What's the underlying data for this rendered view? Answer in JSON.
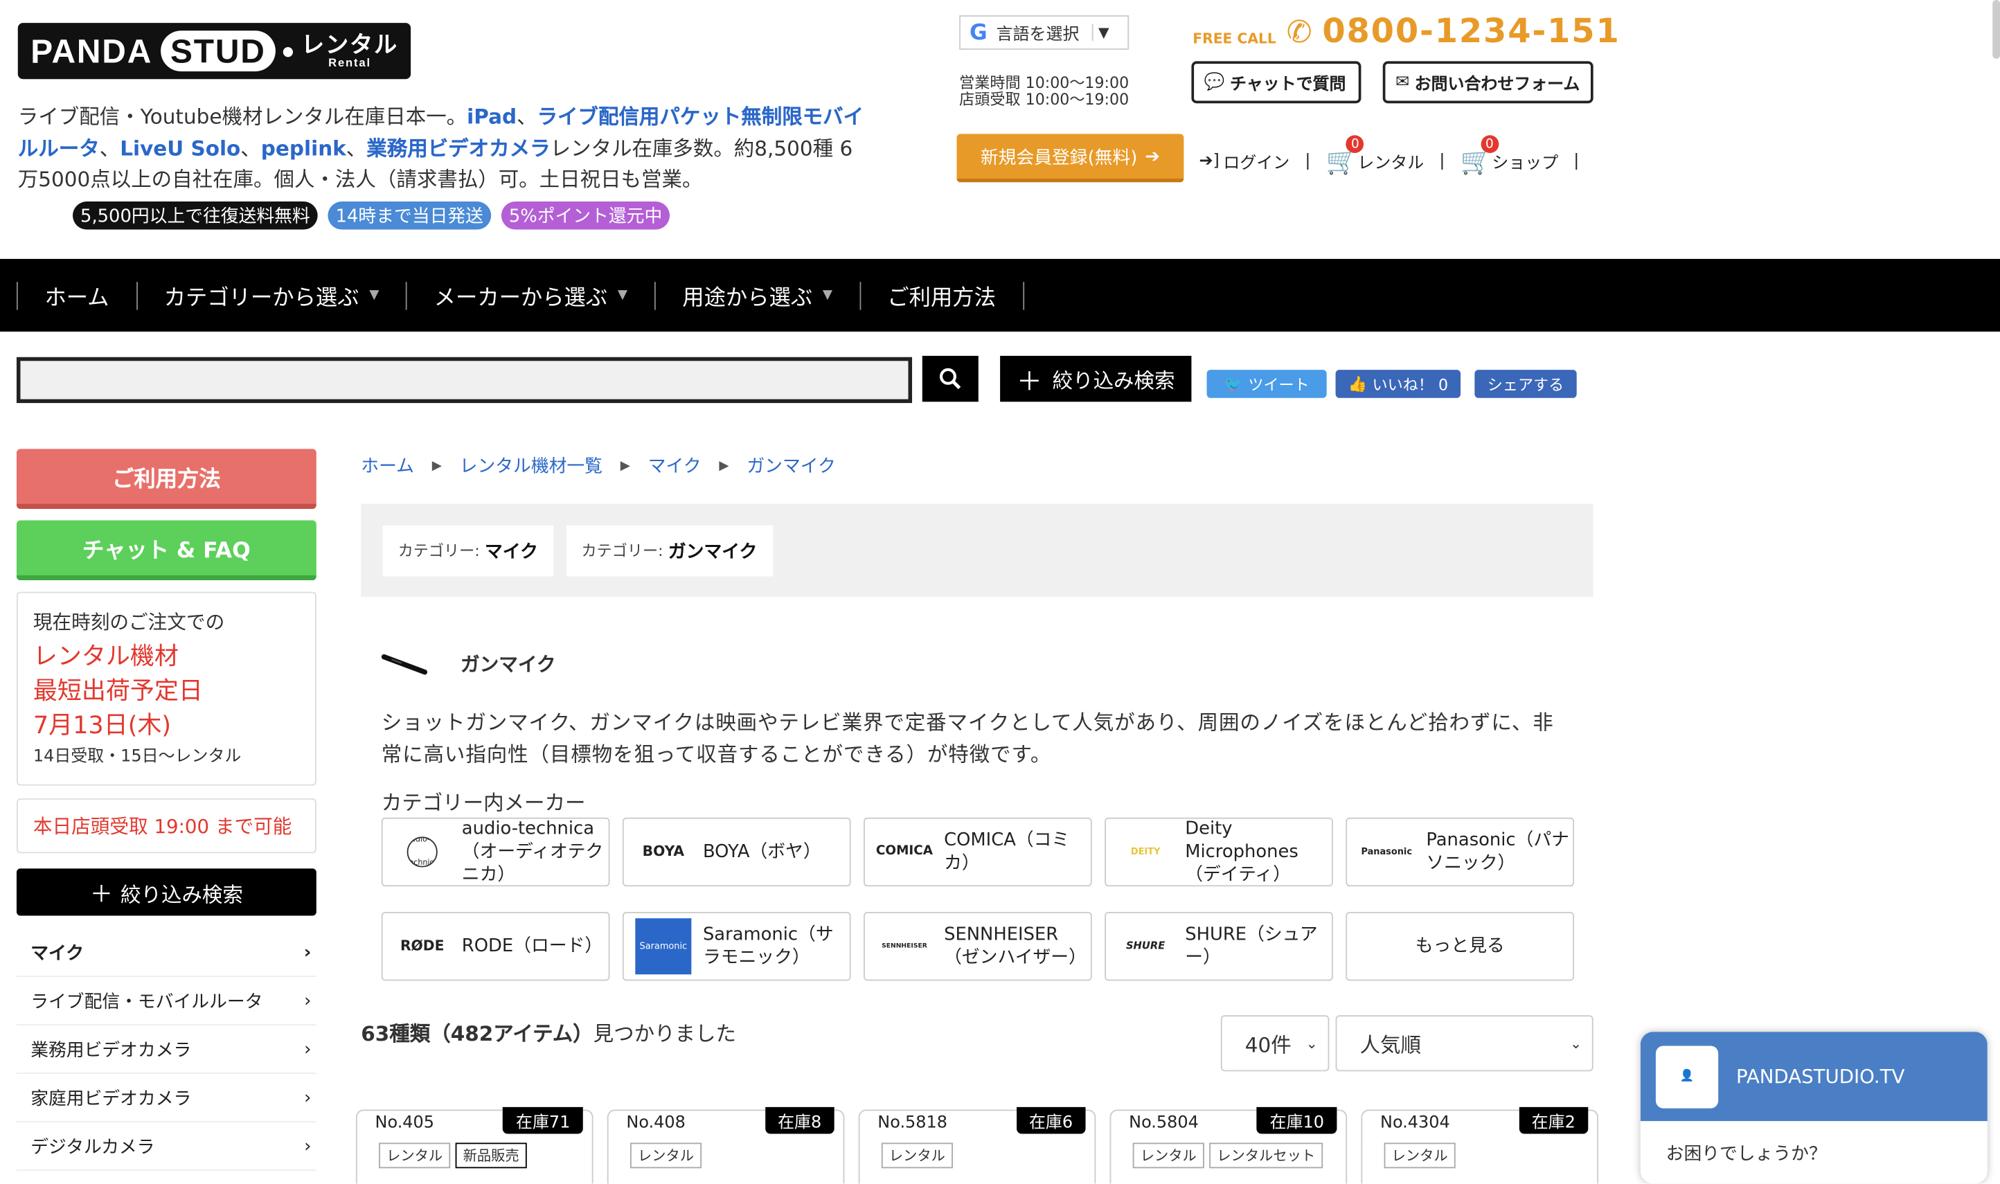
{
  "logo": {
    "panda": "PANDA",
    "studio": "STUD",
    "rental_ja": "レンタル",
    "rental_en": "Rental"
  },
  "intro": {
    "p1": "ライブ配信・Youtube機材レンタル在庫日本一。",
    "l1": "iPad",
    "p2": "、",
    "l2": "ライブ配信用パケット無制限モバイルルータ",
    "p3": "、",
    "l3": "LiveU Solo",
    "p4": "、",
    "l4": "peplink",
    "p5": "、",
    "l5": "業務用ビデオカメラ",
    "p6": "レンタル在庫多数。約8,500種 6万5000点以上の自社在庫。個人・法人（請求書払）可。土日祝日も営業。"
  },
  "badges": [
    {
      "label": "5,500円以上で往復送料無料",
      "color": "#111111"
    },
    {
      "label": "14時まで当日発送",
      "color": "#4a8ad6"
    },
    {
      "label": "5%ポイント還元中",
      "color": "#b45fd6"
    }
  ],
  "lang": {
    "label": "言語を選択"
  },
  "hours": {
    "open": "営業時間 10:00～19:00",
    "store": "店頭受取 10:00～19:00"
  },
  "freecall": {
    "label": "FREE CALL",
    "phone": "0800-1234-151"
  },
  "header_buttons": {
    "chat": "チャットで質問",
    "contact": "お問い合わせフォーム"
  },
  "register": {
    "label": "新規会員登録(無料)"
  },
  "user_links": {
    "login": "ログイン",
    "rental": "レンタル",
    "rental_count": "0",
    "shop": "ショップ",
    "shop_count": "0",
    "sep": "|"
  },
  "nav": [
    {
      "label": "ホーム",
      "caret": false
    },
    {
      "label": "カテゴリーから選ぶ",
      "caret": true
    },
    {
      "label": "メーカーから選ぶ",
      "caret": true
    },
    {
      "label": "用途から選ぶ",
      "caret": true
    },
    {
      "label": "ご利用方法",
      "caret": false
    }
  ],
  "search": {
    "value": "",
    "filter_label": "絞り込み検索"
  },
  "social": {
    "tweet": "ツイート",
    "like": "いいね！ 0",
    "share": "シェアする"
  },
  "sidebar": {
    "usage": "ご利用方法",
    "chat_faq": "チャット & FAQ",
    "ship": {
      "l1": "現在時刻のご注文での",
      "l2": "レンタル機材",
      "l3": "最短出荷予定日",
      "l4": "7月13日(木)",
      "l5": "14日受取・15日〜レンタル"
    },
    "store": "本日店頭受取 19:00 まで可能",
    "filter": "絞り込み検索",
    "categories": [
      "マイク",
      "ライブ配信・モバイルルータ",
      "業務用ビデオカメラ",
      "家庭用ビデオカメラ",
      "デジタルカメラ"
    ]
  },
  "breadcrumb": [
    "ホーム",
    "レンタル機材一覧",
    "マイク",
    "ガンマイク"
  ],
  "tags": [
    {
      "prefix": "カテゴリー:",
      "value": "マイク"
    },
    {
      "prefix": "カテゴリー:",
      "value": "ガンマイク"
    }
  ],
  "category": {
    "title": "ガンマイク",
    "description": "ショットガンマイク、ガンマイクは映画やテレビ業界で定番マイクとして人気があり、周囲のノイズをほとんど拾わずに、非常に高い指向性（目標物を狙って収音することができる）が特徴です。",
    "makers_heading": "カテゴリー内メーカー"
  },
  "makers": [
    {
      "logo": "audio-technica",
      "name": "audio-technica（オーディオテクニカ）"
    },
    {
      "logo": "BOYA",
      "name": "BOYA（ボヤ）"
    },
    {
      "logo": "COMICA",
      "name": "COMICA（コミカ）"
    },
    {
      "logo": "DEITY",
      "name": "Deity Microphones（デイティ）"
    },
    {
      "logo": "Panasonic",
      "name": "Panasonic（パナソニック）"
    },
    {
      "logo": "RØDE",
      "name": "RODE（ロード）"
    },
    {
      "logo": "Saramonic",
      "name": "Saramonic（サラモニック）"
    },
    {
      "logo": "SENNHEISER",
      "name": "SENNHEISER（ゼンハイザー）"
    },
    {
      "logo": "SHURE",
      "name": "SHURE（シュアー）"
    },
    {
      "logo": "",
      "name": "もっと見る"
    }
  ],
  "results": {
    "count": "63種類（482アイテム）",
    "suffix": "見つかりました",
    "per_page": "40件",
    "sort": "人気順"
  },
  "products": [
    {
      "no": "No.405",
      "stock": "在庫71",
      "chips": [
        "レンタル",
        "新品販売"
      ]
    },
    {
      "no": "No.408",
      "stock": "在庫8",
      "chips": [
        "レンタル"
      ]
    },
    {
      "no": "No.5818",
      "stock": "在庫6",
      "chips": [
        "レンタル"
      ]
    },
    {
      "no": "No.5804",
      "stock": "在庫10",
      "chips": [
        "レンタル",
        "レンタルセット"
      ]
    },
    {
      "no": "No.4304",
      "stock": "在庫2",
      "chips": [
        "レンタル"
      ]
    }
  ],
  "chat_widget": {
    "name": "PANDASTUDIO.TV",
    "message": "お困りでしょうか？"
  }
}
